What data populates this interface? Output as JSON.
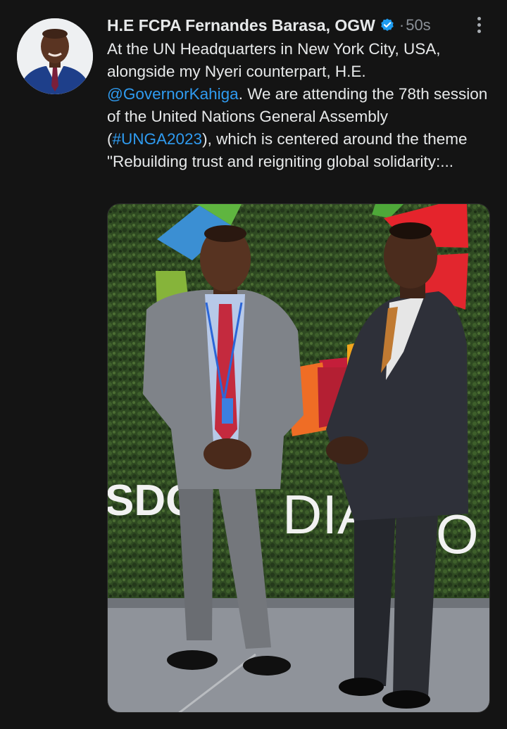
{
  "tweet": {
    "author_name": "H.E FCPA Fernandes Barasa, OGW",
    "separator": "·",
    "time": "50s",
    "text": {
      "part1": "At the UN Headquarters in New York City, USA, alongside my Nyeri counterpart, H.E. ",
      "mention": "@GovernorKahiga",
      "part2": ". We are attending the 78th session of the United Nations General Assembly (",
      "hashtag": "#UNGA2023",
      "part3": "), which is centered around the theme \"Rebuilding trust and reigniting global solidarity:..."
    },
    "icons": {
      "verified": "verified-badge-icon",
      "more": "more-options-icon"
    },
    "photo": {
      "sign_left": "SDG",
      "sign_right": "DIA",
      "sign_end": "O"
    }
  },
  "colors": {
    "background": "#141414",
    "text": "#e7e9ea",
    "secondary": "#8b9198",
    "link": "#2f9bf0",
    "verified": "#1d9bf0"
  }
}
